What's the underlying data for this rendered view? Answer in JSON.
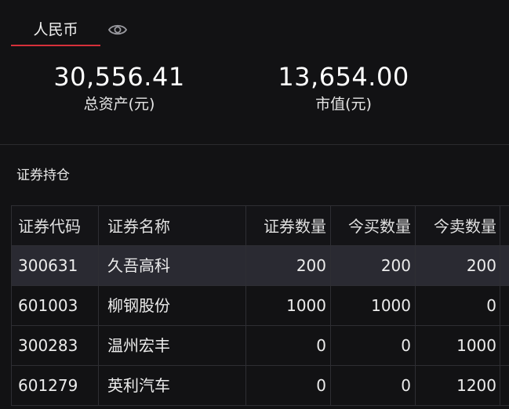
{
  "currency_tab": {
    "label": "人民币",
    "accent": "#d6303a"
  },
  "summary": {
    "total_assets": {
      "value": "30,556.41",
      "label": "总资产(元)"
    },
    "market_value": {
      "value": "13,654.00",
      "label": "市值(元)"
    }
  },
  "holdings": {
    "title": "证券持仓",
    "columns": [
      "证券代码",
      "证券名称",
      "证券数量",
      "今买数量",
      "今卖数量"
    ],
    "rows": [
      {
        "code": "300631",
        "name": "久吾高科",
        "qty": "200",
        "buy": "200",
        "sell": "200"
      },
      {
        "code": "601003",
        "name": "柳钢股份",
        "qty": "1000",
        "buy": "1000",
        "sell": "0"
      },
      {
        "code": "300283",
        "name": "温州宏丰",
        "qty": "0",
        "buy": "0",
        "sell": "1000"
      },
      {
        "code": "601279",
        "name": "英利汽车",
        "qty": "0",
        "buy": "0",
        "sell": "1200"
      }
    ],
    "selected_row": 0
  },
  "icons": {
    "visibility": "eye-icon"
  }
}
